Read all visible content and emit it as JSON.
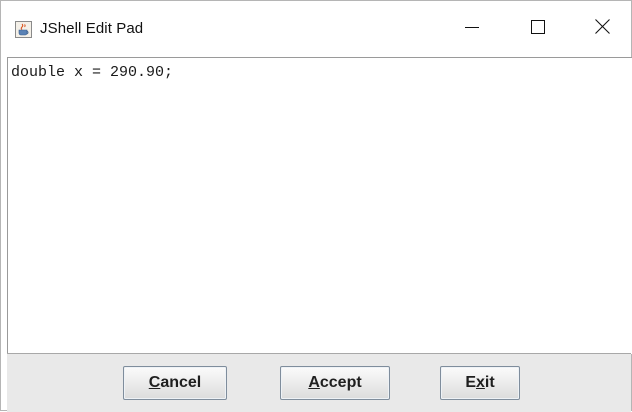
{
  "window": {
    "title": "JShell Edit Pad",
    "icon": "java-cup-icon"
  },
  "titlebar_controls": {
    "minimize_icon": "minimize-icon",
    "maximize_icon": "maximize-icon",
    "close_icon": "close-icon"
  },
  "editor": {
    "content": "double x = 290.90;"
  },
  "buttons": {
    "cancel": {
      "mnemonic": "C",
      "rest": "ancel"
    },
    "accept": {
      "mnemonic": "A",
      "rest": "ccept"
    },
    "exit": {
      "before": "E",
      "mnemonic": "x",
      "rest": "it"
    }
  }
}
